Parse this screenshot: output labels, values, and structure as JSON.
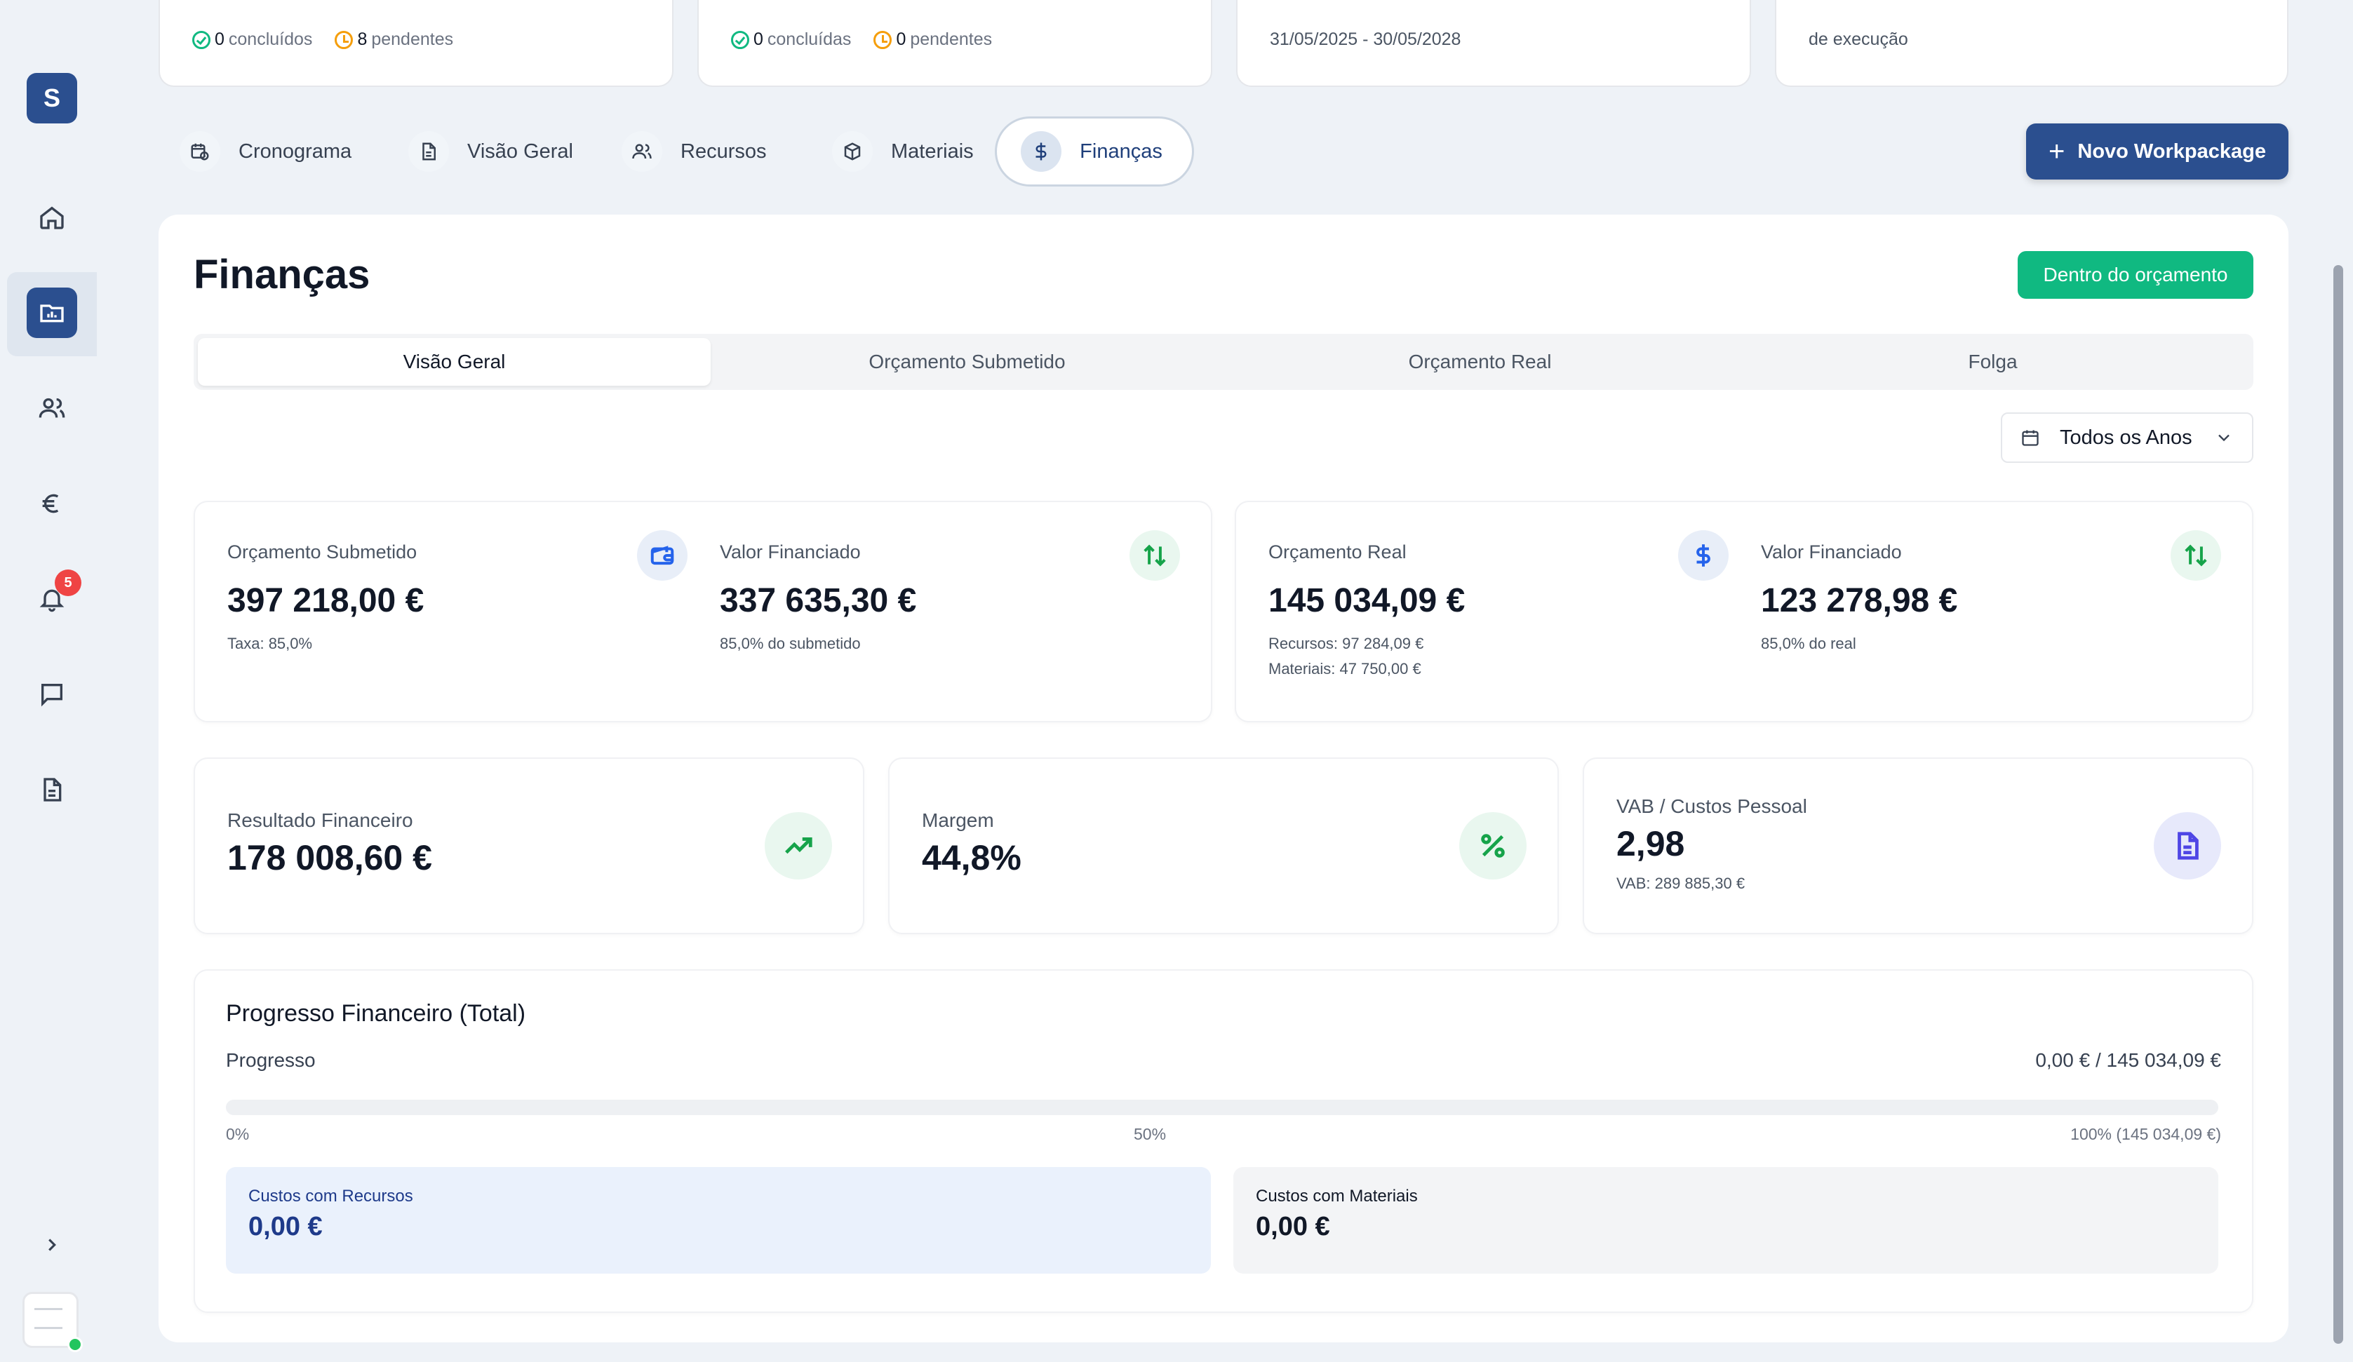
{
  "sidebar": {
    "logo_letter": "S",
    "notification_count": "5",
    "items": [
      {
        "icon": "home-icon"
      },
      {
        "icon": "projects-icon"
      },
      {
        "icon": "users-icon"
      },
      {
        "icon": "euro-icon"
      },
      {
        "icon": "bell-icon"
      },
      {
        "icon": "chat-icon"
      },
      {
        "icon": "document-icon"
      }
    ]
  },
  "top_cards": [
    {
      "done_count": "0",
      "done_label": "concluídos",
      "pending_count": "8",
      "pending_label": "pendentes"
    },
    {
      "done_count": "0",
      "done_label": "concluídas",
      "pending_count": "0",
      "pending_label": "pendentes"
    },
    {
      "text": "31/05/2025 - 30/05/2028"
    },
    {
      "text": "de execução"
    }
  ],
  "tabs": [
    {
      "label": "Cronograma",
      "icon": "calendar-clock-icon"
    },
    {
      "label": "Visão Geral",
      "icon": "file-icon"
    },
    {
      "label": "Recursos",
      "icon": "users-icon"
    },
    {
      "label": "Materiais",
      "icon": "box-icon"
    },
    {
      "label": "Finanças",
      "icon": "dollar-icon",
      "active": true
    }
  ],
  "new_workpackage_label": "Novo Workpackage",
  "page_title": "Finanças",
  "status_badge": "Dentro do orçamento",
  "subtabs": [
    "Visão Geral",
    "Orçamento Submetido",
    "Orçamento Real",
    "Folga"
  ],
  "year_filter": "Todos os Anos",
  "stats_row1": [
    {
      "label": "Orçamento Submetido",
      "value": "397 218,00 €",
      "sub1": "Taxa: 85,0%",
      "icon": "wallet-icon"
    },
    {
      "label": "Valor Financiado",
      "value": "337 635,30 €",
      "sub1": "85,0% do submetido",
      "icon": "arrows-updown-icon"
    },
    {
      "label": "Orçamento Real",
      "value": "145 034,09 €",
      "sub1": "Recursos: 97 284,09 €",
      "sub2": "Materiais: 47 750,00 €",
      "icon": "dollar-icon"
    },
    {
      "label": "Valor Financiado",
      "value": "123 278,98 €",
      "sub1": "85,0% do real",
      "icon": "arrows-updown-icon"
    }
  ],
  "stats_row2": [
    {
      "label": "Resultado Financeiro",
      "value": "178 008,60 €",
      "icon": "trending-up-icon"
    },
    {
      "label": "Margem",
      "value": "44,8%",
      "icon": "percent-icon"
    },
    {
      "label": "VAB / Custos Pessoal",
      "value": "2,98",
      "sub": "VAB: 289 885,30 €",
      "icon": "file-text-icon"
    }
  ],
  "progress": {
    "title": "Progresso Financeiro (Total)",
    "label": "Progresso",
    "amount": "0,00 € / 145 034,09 €",
    "fraction": 0,
    "tick_0": "0%",
    "tick_50": "50%",
    "tick_100": "100% (145 034,09 €)"
  },
  "costs": [
    {
      "label": "Custos com Recursos",
      "value": "0,00 €"
    },
    {
      "label": "Custos com Materiais",
      "value": "0,00 €"
    }
  ]
}
